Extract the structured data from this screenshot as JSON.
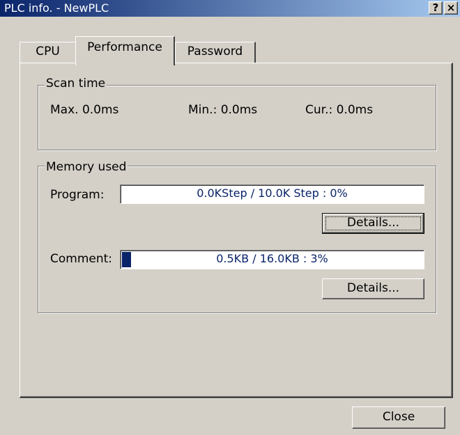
{
  "window": {
    "title": "PLC info. - NewPLC",
    "help_button": "?",
    "close_button": "×"
  },
  "tabs": [
    {
      "label": "CPU",
      "selected": false
    },
    {
      "label": "Performance",
      "selected": true
    },
    {
      "label": "Password",
      "selected": false
    }
  ],
  "scan_time": {
    "title": "Scan time",
    "max": "Max.  0.0ms",
    "min": "Min.:  0.0ms",
    "cur": "Cur.:  0.0ms"
  },
  "memory_used": {
    "title": "Memory used",
    "program": {
      "label": "Program:",
      "bar_text": "0.0KStep / 10.0K Step : 0%",
      "percent": 0,
      "details_label": "Details..."
    },
    "comment": {
      "label": "Comment:",
      "bar_text": "0.5KB / 16.0KB : 3%",
      "percent": 3,
      "details_label": "Details..."
    }
  },
  "footer": {
    "close_label": "Close"
  },
  "colors": {
    "titlebar_start": "#0a246a",
    "titlebar_end": "#a6caf0",
    "progress_fill": "#0a246a",
    "dialog_face": "#d4d0c8"
  }
}
